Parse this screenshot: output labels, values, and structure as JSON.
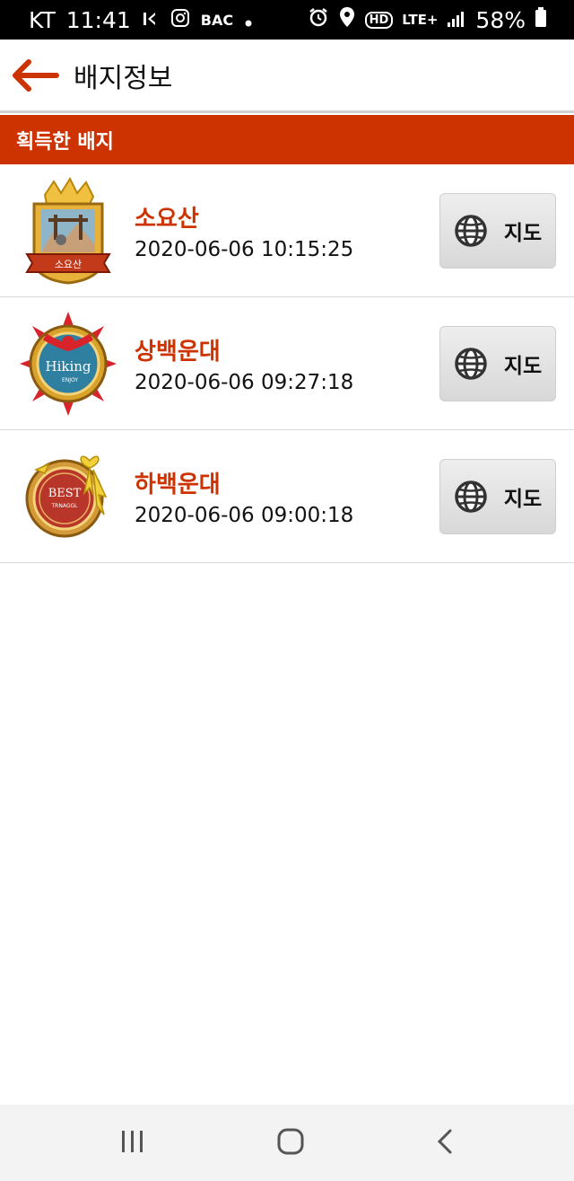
{
  "status_bar": {
    "carrier": "KT",
    "time": "11:41",
    "app_icons": [
      "k-icon",
      "instagram-icon",
      "bac-icon"
    ],
    "bac_text": "BAC",
    "network": "LTE+",
    "hd": "HD",
    "battery": "58%"
  },
  "app_bar": {
    "title": "배지정보"
  },
  "section": {
    "title": "획득한 배지"
  },
  "badges": [
    {
      "name": "소요산",
      "date": "2020-06-06 10:15:25",
      "map_label": "지도",
      "badge_text": "소요산"
    },
    {
      "name": "상백운대",
      "date": "2020-06-06 09:27:18",
      "map_label": "지도",
      "badge_text": "Hiking",
      "badge_sub": "ENJOY"
    },
    {
      "name": "하백운대",
      "date": "2020-06-06 09:00:18",
      "map_label": "지도",
      "badge_text": "BEST",
      "badge_sub": "TRNAGGL"
    }
  ],
  "colors": {
    "accent": "#cc3300",
    "header_bg": "#cc3300",
    "status_bg": "#000000"
  }
}
